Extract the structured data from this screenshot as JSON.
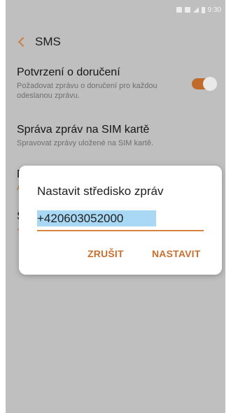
{
  "status_bar": {
    "time": "9:30",
    "icons": [
      "nfc-icon",
      "wifi-icon",
      "signal-icon",
      "battery-icon"
    ]
  },
  "app_bar": {
    "title": "SMS"
  },
  "settings": [
    {
      "title": "Potvrzení o doručení",
      "subtitle": "Požadovat zprávu o doručení pro každou odeslanou zprávu.",
      "toggle_on": true
    },
    {
      "title": "Správa zpráv na SIM kartě",
      "subtitle": "Spravovat zprávy uložené na SIM kartě."
    },
    {
      "title": "R",
      "subtitle": "A"
    },
    {
      "title": "S",
      "subtitle": "+"
    }
  ],
  "dialog": {
    "title": "Nastavit středisko zpráv",
    "value": "+420603052000",
    "cancel_label": "ZRUŠIT",
    "ok_label": "NASTAVIT"
  },
  "colors": {
    "accent": "#c8702e",
    "overlay": "#bfbfbf"
  }
}
